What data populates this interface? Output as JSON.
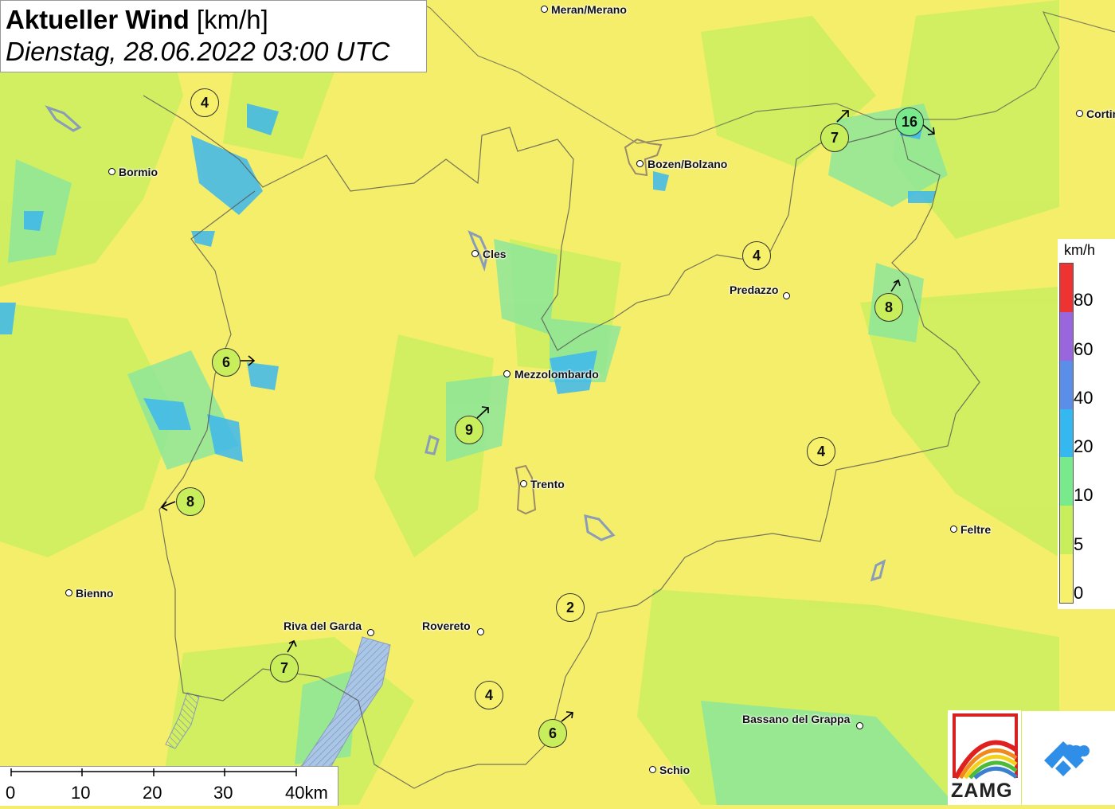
{
  "title": {
    "main": "Aktueller Wind",
    "unit": "[km/h]",
    "datetime": "Dienstag, 28.06.2022 03:00 UTC"
  },
  "cities": [
    {
      "name": "Meran/Merano"
    },
    {
      "name": "Bormio"
    },
    {
      "name": "Bozen/Bolzano"
    },
    {
      "name": "Cortina"
    },
    {
      "name": "Cles"
    },
    {
      "name": "Predazzo"
    },
    {
      "name": "Mezzolombardo"
    },
    {
      "name": "Trento"
    },
    {
      "name": "Feltre"
    },
    {
      "name": "Bienno"
    },
    {
      "name": "Riva del Garda"
    },
    {
      "name": "Rovereto"
    },
    {
      "name": "Bassano del Grappa"
    },
    {
      "name": "Schio"
    }
  ],
  "stations": [
    {
      "value": "4",
      "direction": "none"
    },
    {
      "value": "7",
      "direction": "NE"
    },
    {
      "value": "16",
      "direction": "SE"
    },
    {
      "value": "4",
      "direction": "none"
    },
    {
      "value": "8",
      "direction": "NE"
    },
    {
      "value": "6",
      "direction": "E"
    },
    {
      "value": "9",
      "direction": "NE"
    },
    {
      "value": "4",
      "direction": "none"
    },
    {
      "value": "8",
      "direction": "W"
    },
    {
      "value": "2",
      "direction": "none"
    },
    {
      "value": "7",
      "direction": "NE"
    },
    {
      "value": "4",
      "direction": "none"
    },
    {
      "value": "6",
      "direction": "NE"
    }
  ],
  "legend": {
    "unit": "km/h",
    "ticks": [
      "80",
      "60",
      "40",
      "20",
      "10",
      "5",
      "0"
    ],
    "colors": [
      "#ee3333",
      "#9a66dd",
      "#5a8ee8",
      "#35b8f0",
      "#79ea8c",
      "#c9ee5c",
      "#f6f06a"
    ]
  },
  "scale": {
    "labels": [
      "0",
      "10",
      "20",
      "30",
      "40km"
    ]
  },
  "logos": {
    "zamg": "ZAMG"
  },
  "colors": {
    "calm": "#f6f06a",
    "light": "#c9ee5c",
    "moderate": "#79ea8c",
    "strong": "#35b8f0"
  }
}
